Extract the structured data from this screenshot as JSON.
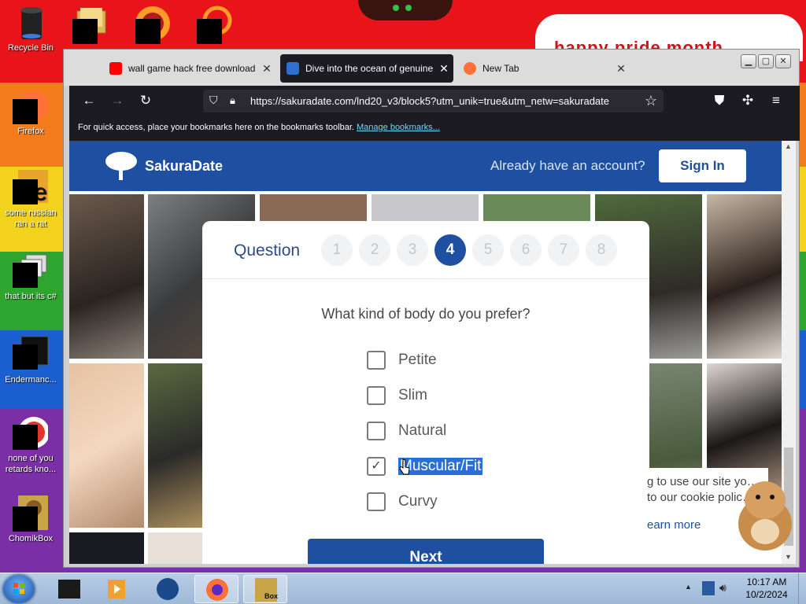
{
  "desktop": {
    "icons": [
      {
        "label": "Recycle Bin"
      },
      {
        "label": "Firefox"
      },
      {
        "label": "some russian ran a rat"
      },
      {
        "label": "that but its c#"
      },
      {
        "label": "Endermanc..."
      },
      {
        "label": "none of you retards kno..."
      },
      {
        "label": "ChomikBox"
      }
    ],
    "note_text": "happy pride month"
  },
  "browser": {
    "tabs": [
      {
        "title": "wall game hack free download",
        "icon": "youtube-icon",
        "color": "#ff0000"
      },
      {
        "title": "Dive into the ocean of genuine",
        "icon": "sakura-icon",
        "color": "#2f6fd0",
        "active": true
      },
      {
        "title": "New Tab",
        "icon": "firefox-icon",
        "color": "#ff7139"
      }
    ],
    "url": "https://sakuradate.com/lnd20_v3/block5?utm_unik=true&utm_netw=sakuradate",
    "bookmarks_text": "For quick access, place your bookmarks here on the bookmarks toolbar.",
    "bookmarks_link": "Manage bookmarks..."
  },
  "site": {
    "brand": "SakuraDate",
    "account_prompt": "Already have an account?",
    "signin_label": "Sign In",
    "brand_color": "#1f4fa0",
    "question_label": "Question",
    "steps": [
      "1",
      "2",
      "3",
      "4",
      "5",
      "6",
      "7",
      "8"
    ],
    "active_step": "4",
    "question": "What kind of body do you prefer?",
    "options": [
      {
        "label": "Petite",
        "checked": false
      },
      {
        "label": "Slim",
        "checked": false
      },
      {
        "label": "Natural",
        "checked": false
      },
      {
        "label": "Muscular/Fit",
        "checked": true
      },
      {
        "label": "Curvy",
        "checked": false
      }
    ],
    "next_label": "Next",
    "cookie_text": "g to use our site yo… to our cookie polic…",
    "cookie_link": "earn more"
  },
  "taskbar": {
    "time": "10:17 AM",
    "date": "10/2/2024",
    "box_label": "Box"
  }
}
